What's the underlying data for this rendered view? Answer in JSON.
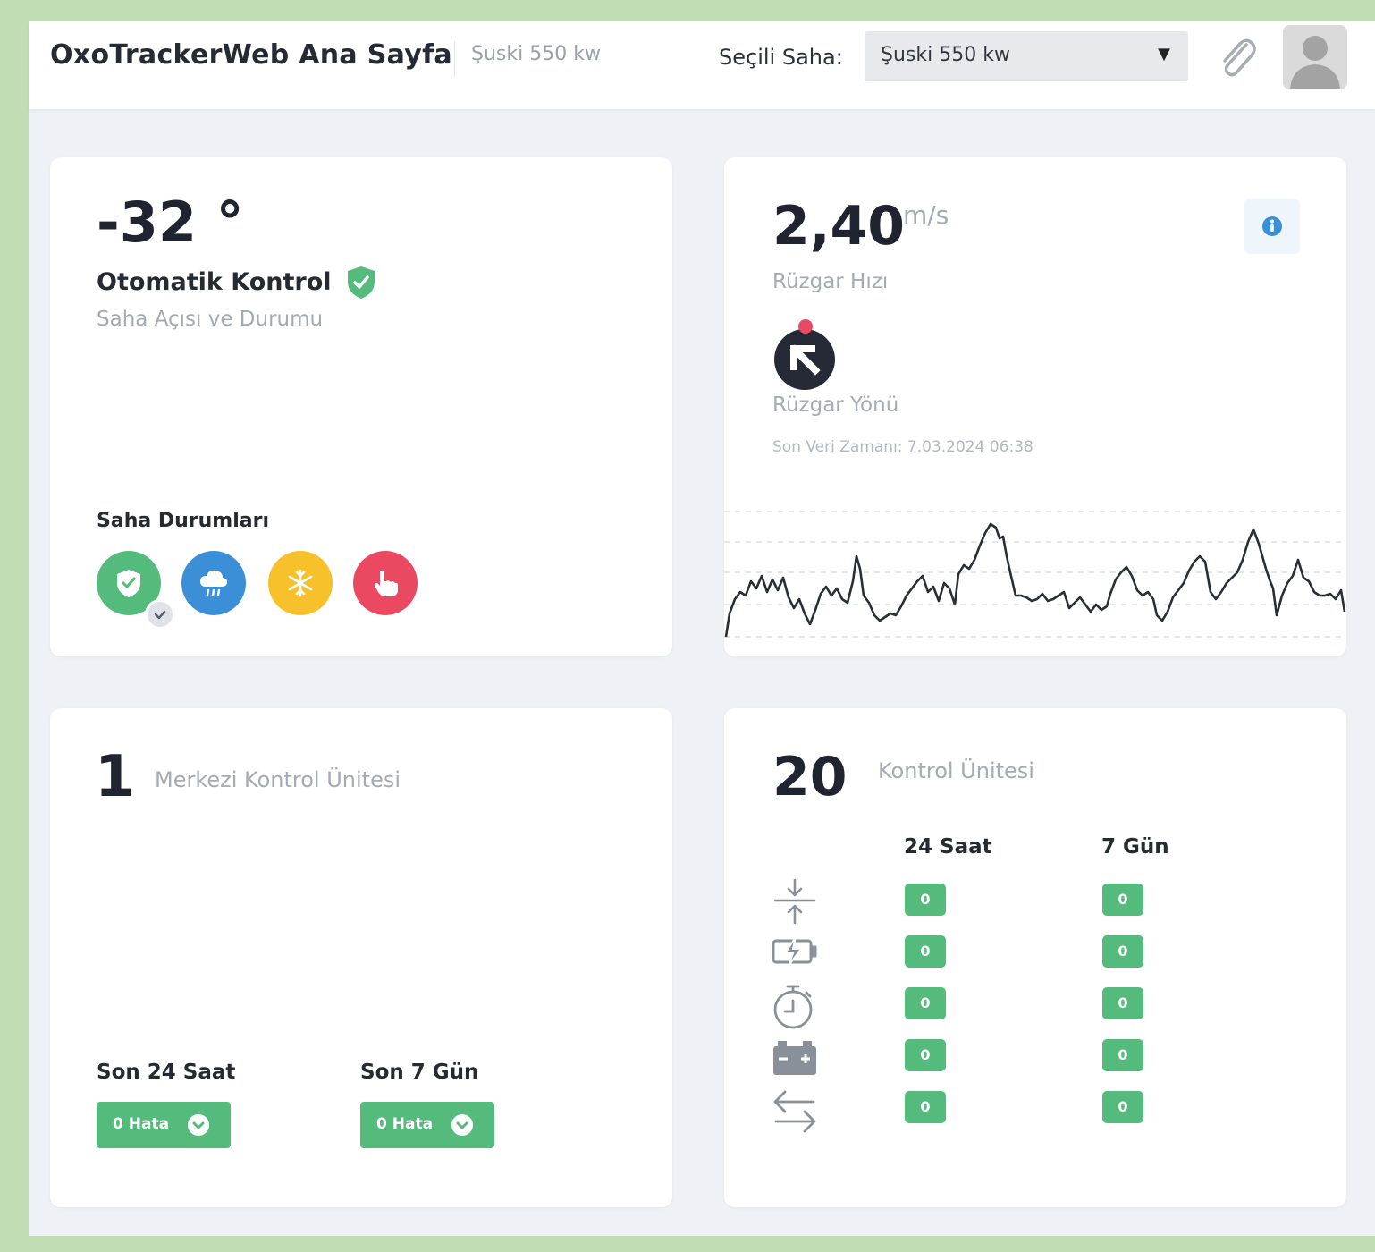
{
  "header": {
    "title": "OxoTrackerWeb Ana Sayfa",
    "subtitle": "Şuski 550 kw",
    "select_label": "Seçili Saha:",
    "select_value": "Şuski 550 kw"
  },
  "angle_card": {
    "value": "-32 °",
    "mode_label": "Otomatik Kontrol",
    "description": "Saha Açısı ve Durumu",
    "statuses_title": "Saha Durumları",
    "status_icons": [
      "shield-check-icon",
      "rain-cloud-icon",
      "snowflake-icon",
      "hand-pointer-icon"
    ],
    "status_colors": [
      "#55bb7c",
      "#3a8fd6",
      "#f6c12a",
      "#eb4862"
    ]
  },
  "wind_card": {
    "speed_value": "2,40",
    "speed_unit": "m/s",
    "speed_label": "Rüzgar Hızı",
    "direction_label": "Rüzgar Yönü",
    "last_data": "Son Veri Zamanı: 7.03.2024 06:38"
  },
  "central_card": {
    "count": "1",
    "label": "Merkezi Kontrol Ünitesi",
    "last24_label": "Son 24 Saat",
    "last7_label": "Son 7 Gün",
    "last24_errors": "0 Hata",
    "last7_errors": "0 Hata"
  },
  "control_card": {
    "count": "20",
    "label": "Kontrol Ünitesi",
    "col_24": "24 Saat",
    "col_7": "7 Gün",
    "rows": [
      {
        "icon": "compress-arrows-icon",
        "h24": "0",
        "d7": "0"
      },
      {
        "icon": "charging-battery-icon",
        "h24": "0",
        "d7": "0"
      },
      {
        "icon": "stopwatch-icon",
        "h24": "0",
        "d7": "0"
      },
      {
        "icon": "car-battery-icon",
        "h24": "0",
        "d7": "0"
      },
      {
        "icon": "exchange-arrows-icon",
        "h24": "0",
        "d7": "0"
      }
    ]
  }
}
